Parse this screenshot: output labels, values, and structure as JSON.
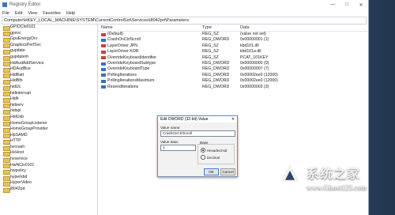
{
  "window": {
    "title": "Registry Editor",
    "minimize": "—",
    "maximize": "□",
    "close": "✕"
  },
  "menu": [
    "File",
    "Edit",
    "View",
    "Favorites",
    "Help"
  ],
  "address": "Computer\\HKEY_LOCAL_MACHINE\\SYSTEM\\CurrentControlSet\\Services\\i8042prt\\Parameters",
  "tree": [
    "GPIOClx0101",
    "gpsvc",
    "GpuEnergyDrv",
    "GraphicsPerfSvc",
    "gupdate",
    "gupdatem",
    "HdAudAddService",
    "HDAudBus",
    "HidBatt",
    "HidBth",
    "hidi2c",
    "hidinterrupt",
    "HidIr",
    "hidserv",
    "hidspi",
    "HidUsb",
    "HomeGroupListener",
    "HomeGroupProvider",
    "HpSAMD",
    "HTTP",
    "hvcrash",
    "HvHost",
    "hvservice",
    "HwNClx0101",
    "hwpolicy",
    "hyperkbd",
    "HyperVideo",
    "i8042prt"
  ],
  "columns": {
    "name": "Name",
    "type": "Type",
    "data": "Data"
  },
  "values": [
    {
      "icon": "sz",
      "name": "(Default)",
      "type": "REG_SZ",
      "data": "(value not set)"
    },
    {
      "icon": "dw",
      "name": "CrashOnCtrlScroll",
      "type": "REG_DWORD",
      "data": "0x00000001 (1)"
    },
    {
      "icon": "sz",
      "name": "LayerDriver JPN",
      "type": "REG_SZ",
      "data": "kbd101.dll"
    },
    {
      "icon": "sz",
      "name": "LayerDriver KOR",
      "type": "REG_SZ",
      "data": "kbd101a.dll"
    },
    {
      "icon": "sz",
      "name": "OverrideKeyboardIdentifier",
      "type": "REG_SZ",
      "data": "PCAT_101KEY"
    },
    {
      "icon": "dw",
      "name": "OverrideKeyboardSubtype",
      "type": "REG_DWORD",
      "data": "0x00000000 (0)"
    },
    {
      "icon": "dw",
      "name": "OverrideKeyboardType",
      "type": "REG_DWORD",
      "data": "0x00000007 (7)"
    },
    {
      "icon": "dw",
      "name": "PollingIterations",
      "type": "REG_DWORD",
      "data": "0x00002ee0 (12000)"
    },
    {
      "icon": "dw",
      "name": "PollingIterationsMaximum",
      "type": "REG_DWORD",
      "data": "0x00002ee0 (12000)"
    },
    {
      "icon": "dw",
      "name": "ResendIterations",
      "type": "REG_DWORD",
      "data": "0x00000003 (3)"
    }
  ],
  "dialog": {
    "title": "Edit DWORD (32-bit) Value",
    "close": "✕",
    "value_name_label": "Value name:",
    "value_name": "CrashOnCtrlScroll",
    "value_data_label": "Value data:",
    "value_data": "1",
    "base_label": "Base",
    "hex_label": "Hexadecimal",
    "dec_label": "Decimal",
    "base_selected": "hex",
    "ok": "OK",
    "cancel": "Cancel"
  },
  "watermark": {
    "title": "系统之家",
    "url": "www.Ghost123.com"
  }
}
